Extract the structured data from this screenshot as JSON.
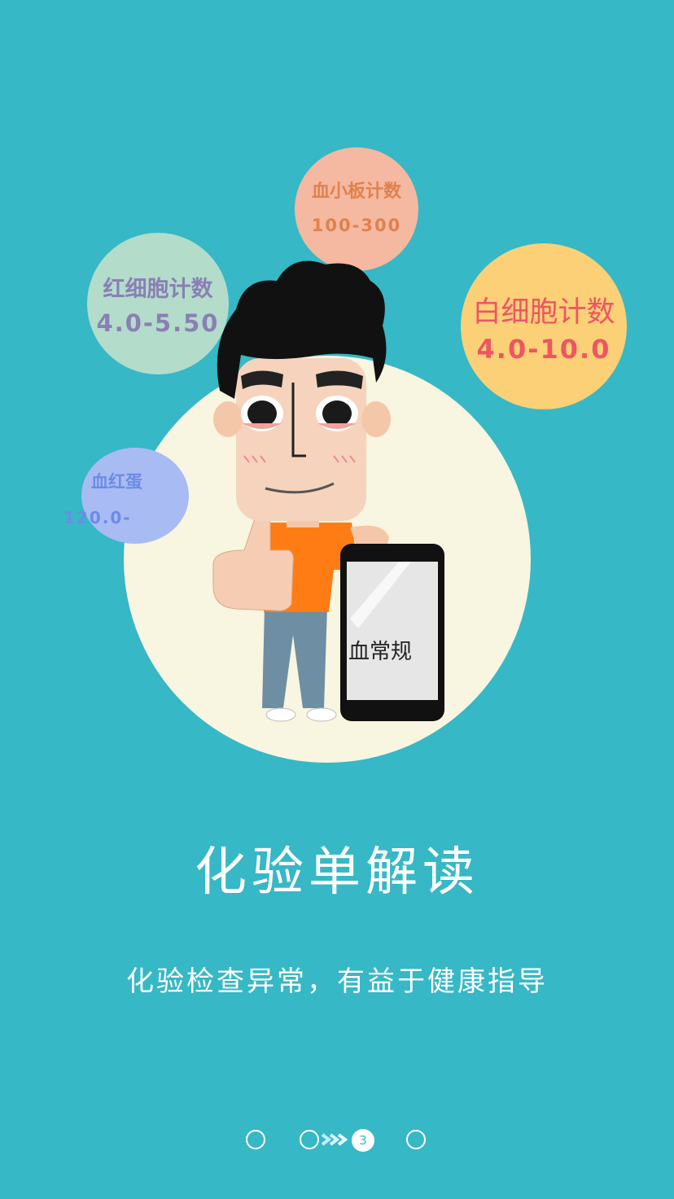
{
  "bubbles": {
    "platelet": {
      "title": "血小板计数",
      "value": "100-300"
    },
    "rbc": {
      "title": "红细胞计数",
      "value": "4.0-5.50"
    },
    "wbc": {
      "title": "白细胞计数",
      "value": "4.0-10.0"
    },
    "hemoglobin": {
      "title": "血红蛋",
      "value": "120.0-"
    }
  },
  "phone_screen_label": "血常规",
  "title": "化验单解读",
  "subtitle": "化验检查异常，有益于健康指导",
  "pager": {
    "active_page": "3",
    "total_pages": 4
  },
  "colors": {
    "background": "#36b8c6",
    "center_circle": "#f8f5e0",
    "platelet_bubble": "#f5b8a0",
    "rbc_bubble": "#b3dccb",
    "wbc_bubble": "#fcd077",
    "hemoglobin_bubble": "#a9bbf3"
  }
}
